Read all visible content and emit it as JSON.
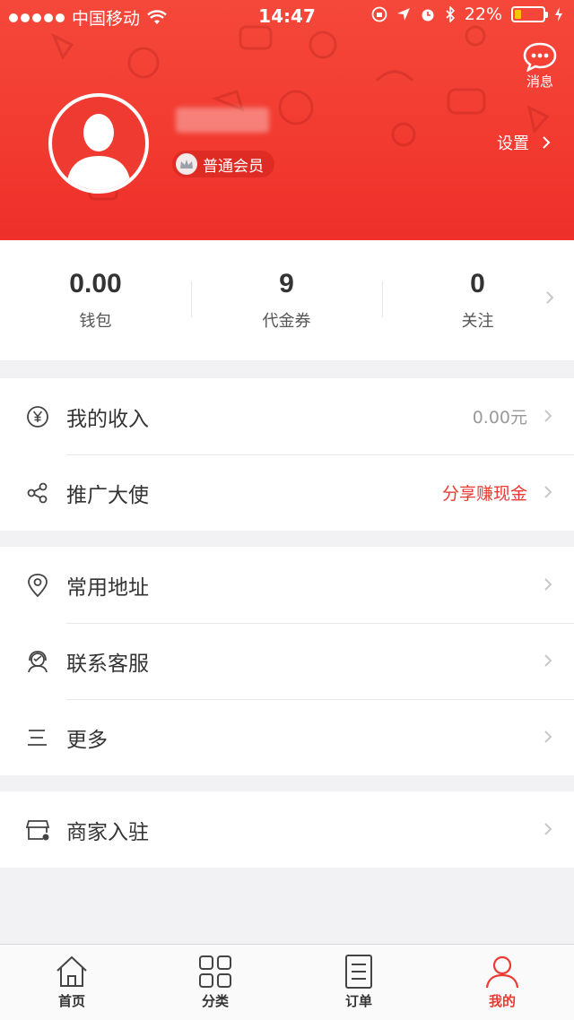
{
  "status_bar": {
    "carrier": "中国移动",
    "time": "14:47",
    "battery": "22%"
  },
  "header": {
    "message_label": "消息",
    "member_level": "普通会员",
    "settings_label": "设置"
  },
  "stats": [
    {
      "value": "0.00",
      "label": "钱包"
    },
    {
      "value": "9",
      "label": "代金券"
    },
    {
      "value": "0",
      "label": "关注"
    }
  ],
  "menu": {
    "income": {
      "label": "我的收入",
      "value": "0.00元"
    },
    "promoter": {
      "label": "推广大使",
      "value": "分享赚现金"
    },
    "address": {
      "label": "常用地址"
    },
    "service": {
      "label": "联系客服"
    },
    "more": {
      "label": "更多"
    },
    "merchant": {
      "label": "商家入驻"
    }
  },
  "tabbar": [
    {
      "label": "首页",
      "icon": "home-icon"
    },
    {
      "label": "分类",
      "icon": "category-icon"
    },
    {
      "label": "订单",
      "icon": "order-icon"
    },
    {
      "label": "我的",
      "icon": "profile-icon",
      "active": true
    }
  ],
  "colors": {
    "accent": "#ea3a32",
    "header_red": "#f23a30",
    "battery_yellow": "#f7c600"
  }
}
